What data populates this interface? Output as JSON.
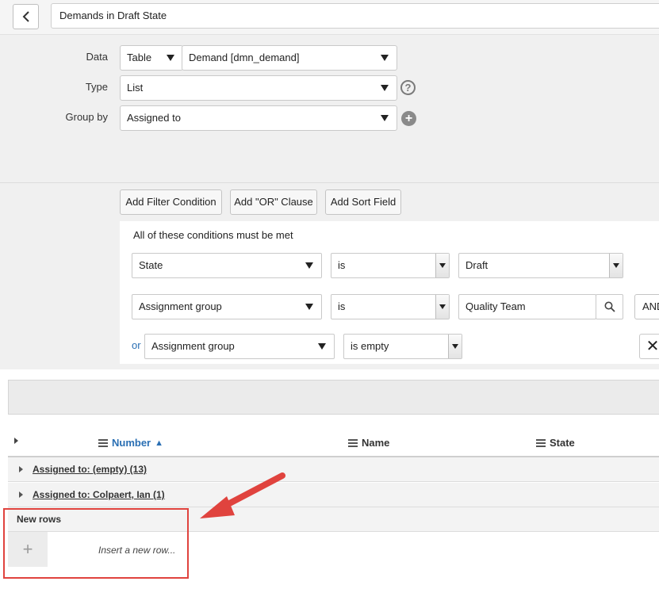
{
  "header": {
    "title": "Demands in Draft State"
  },
  "config": {
    "data_label": "Data",
    "data_source_type": "Table",
    "data_table": "Demand [dmn_demand]",
    "type_label": "Type",
    "type_value": "List",
    "group_by_label": "Group by",
    "group_by_value": "Assigned to",
    "help_symbol": "?",
    "add_symbol": "+"
  },
  "filter": {
    "add_filter_condition": "Add Filter Condition",
    "add_or_clause": "Add \"OR\" Clause",
    "add_sort_field": "Add Sort Field",
    "conditions_title": "All of these conditions must be met",
    "conditions": [
      {
        "field": "State",
        "operator": "is",
        "value": "Draft"
      },
      {
        "field": "Assignment group",
        "operator": "is",
        "value": "Quality Team",
        "conjunction": "AND"
      }
    ],
    "or_label": "or",
    "or_condition": {
      "field": "Assignment group",
      "operator": "is empty"
    },
    "remove_symbol": "✕"
  },
  "list": {
    "columns": [
      "Number",
      "Name",
      "State"
    ],
    "sort_indicator": "▲",
    "groups": [
      "Assigned to: (empty) (13)",
      "Assigned to: Colpaert, Ian (1)"
    ],
    "new_rows_label": "New rows",
    "insert_row_placeholder": "Insert a new row...",
    "insert_symbol": "+"
  },
  "colors": {
    "accent_link": "#2a6fb3",
    "annotation_red": "#e0433e"
  }
}
